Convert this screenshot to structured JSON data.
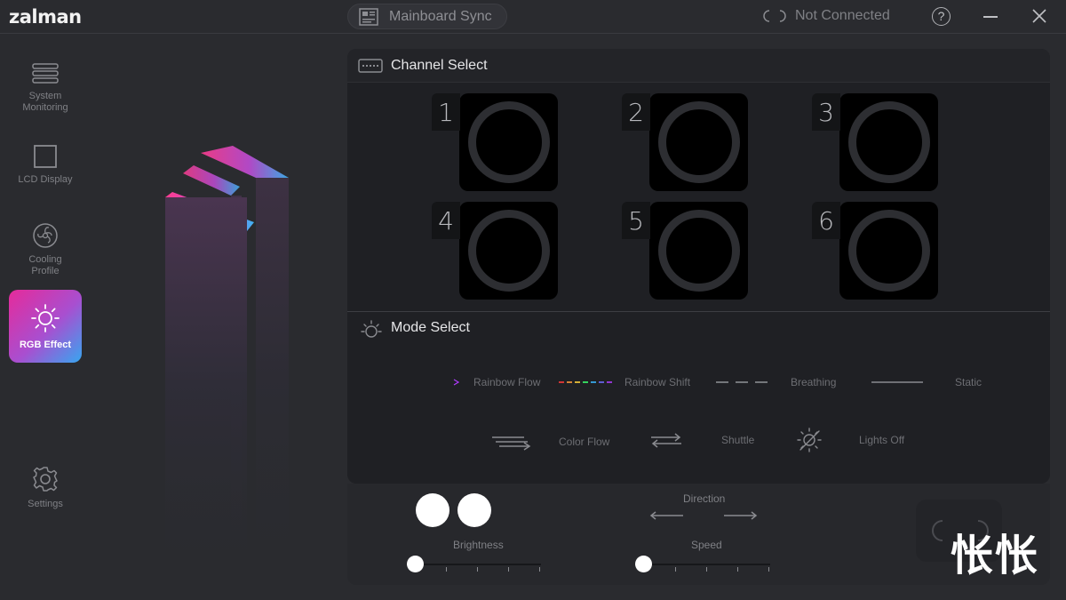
{
  "app": {
    "logo": "zalman"
  },
  "titlebar": {
    "mainboard_sync": "Mainboard Sync",
    "connection_status": "Not Connected",
    "help": "?"
  },
  "sidebar": {
    "items": [
      {
        "label": "System Monitoring",
        "icon": "monitoring-icon"
      },
      {
        "label": "LCD Display",
        "icon": "lcd-display-icon"
      },
      {
        "label": "Cooling Profile",
        "icon": "fan-icon"
      },
      {
        "label": "RGB Effect",
        "icon": "sun-icon",
        "active": true
      },
      {
        "label": "Settings",
        "icon": "gear-icon"
      }
    ]
  },
  "channel_select": {
    "title": "Channel Select",
    "channels": [
      "1",
      "2",
      "3",
      "4",
      "5",
      "6"
    ]
  },
  "mode_select": {
    "title": "Mode Select",
    "modes": [
      "Rainbow Flow",
      "Rainbow Shift",
      "Breathing",
      "Static",
      "Color Flow",
      "Shuttle",
      "Lights Off"
    ]
  },
  "controls": {
    "brightness_label": "Brightness",
    "direction_label": "Direction",
    "speed_label": "Speed",
    "brightness_level": 0,
    "speed_level": 0
  },
  "colors": {
    "accent_pink": "#e62a9a",
    "accent_blue": "#37a6f0",
    "panel": "#1f2024",
    "background": "#2a2b2f"
  },
  "watermark": "怅怅"
}
